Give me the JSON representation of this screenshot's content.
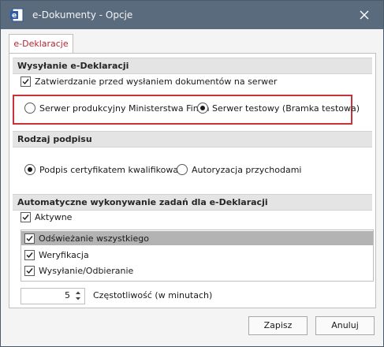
{
  "window": {
    "title": "e-Dokumenty - Opcje",
    "titlebar_color": "#5a6b7d",
    "app_icon": "document-e-icon",
    "close_icon": "close-icon"
  },
  "tabs": [
    {
      "label": "e-Deklaracje",
      "active": true
    }
  ],
  "sections": {
    "sending": {
      "header": "Wysyłanie e-Deklaracji",
      "confirm_checkbox": {
        "label": "Zatwierdzanie przed wysłaniem dokumentów na serwer",
        "checked": true
      },
      "server_options": [
        {
          "label": "Serwer produkcyjny Ministerstwa Finan",
          "selected": false
        },
        {
          "label": "Serwer testowy (Bramka testowa)",
          "selected": true
        }
      ],
      "highlight_color": "#c8323a"
    },
    "signature": {
      "header": "Rodzaj podpisu",
      "options": [
        {
          "label": "Podpis certyfikatem kwalifikowan",
          "selected": true
        },
        {
          "label": "Autoryzacja przychodami",
          "selected": false
        }
      ]
    },
    "automation": {
      "header": "Automatyczne wykonywanie zadań dla e-Deklaracji",
      "active_checkbox": {
        "label": "Aktywne",
        "checked": true
      },
      "tasks": [
        {
          "label": "Odświeżanie wszystkiego",
          "checked": true,
          "selected": true
        },
        {
          "label": "Weryfikacja",
          "checked": true,
          "selected": false
        },
        {
          "label": "Wysyłanie/Odbieranie",
          "checked": true,
          "selected": false
        }
      ],
      "frequency": {
        "value": "5",
        "label": "Częstotliwość (w minutach)"
      }
    }
  },
  "buttons": {
    "save": "Zapisz",
    "cancel": "Anuluj"
  }
}
